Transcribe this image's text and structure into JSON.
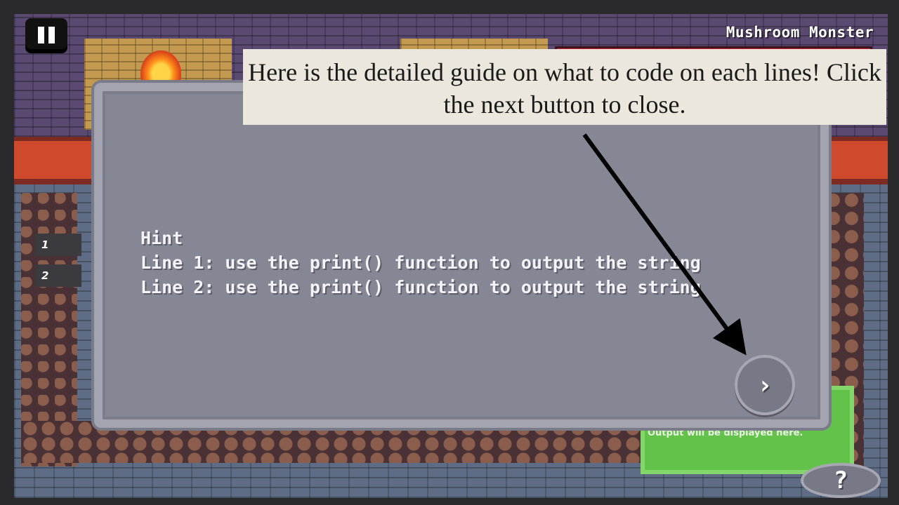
{
  "enemy": {
    "name": "Mushroom Monster",
    "hp_color": "#c8283a"
  },
  "hint": {
    "title": "Hint",
    "lines": [
      "Line 1: use the print() function to output the string",
      "Line 2: use the print() function to output the string"
    ],
    "next_label": "›"
  },
  "code_lines": [
    "1",
    "2"
  ],
  "output": {
    "placeholder": "Output will be displayed here."
  },
  "help_label": "?",
  "tutorial": {
    "text": "Here is the detailed guide on what to code on each lines! Click the next button to close."
  }
}
